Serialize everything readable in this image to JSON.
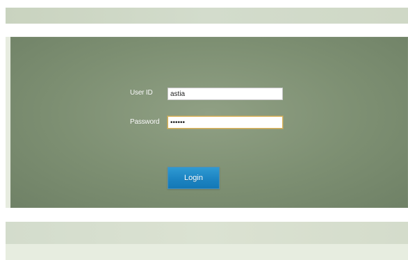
{
  "login_form": {
    "user_id_label": "User ID",
    "user_id_value": "astia",
    "password_label": "Password",
    "password_masked": "••••••",
    "login_button_label": "Login"
  },
  "colors": {
    "panel_background": "#7f9074",
    "button_background": "#1f87c5",
    "active_input_border": "#e0b457"
  }
}
